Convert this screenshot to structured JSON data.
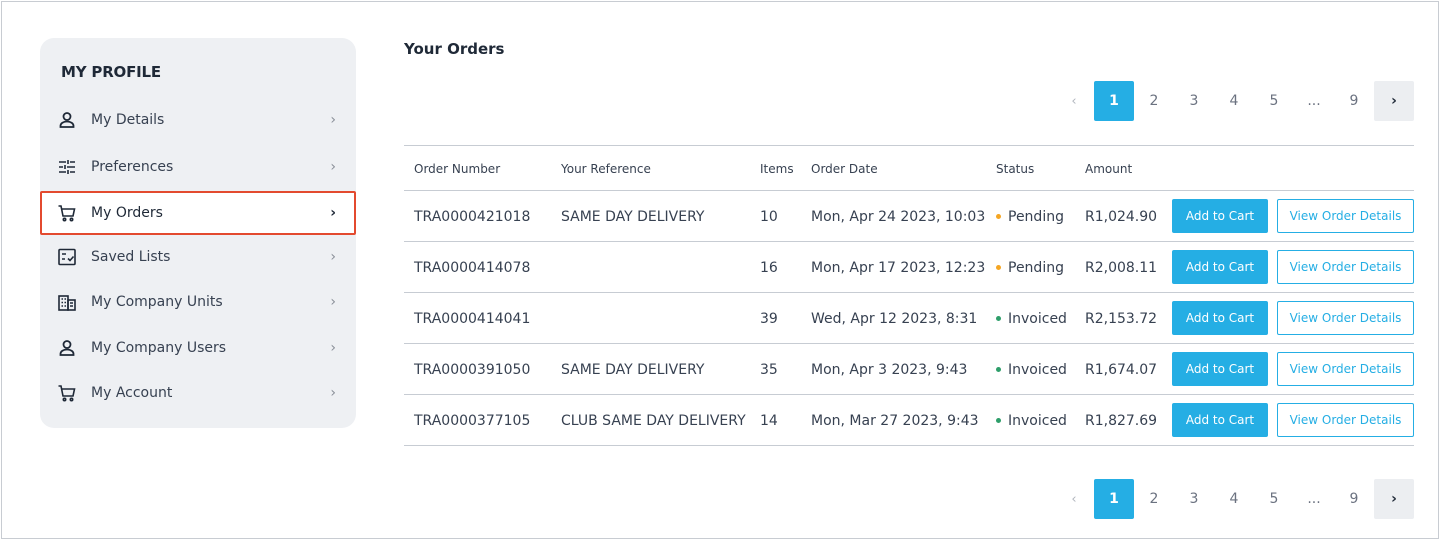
{
  "sidebar": {
    "title": "MY PROFILE",
    "items": [
      {
        "label": "My Details",
        "icon": "user-icon"
      },
      {
        "label": "Preferences",
        "icon": "sliders-icon"
      },
      {
        "label": "My Orders",
        "icon": "cart-icon",
        "active": true
      },
      {
        "label": "Saved Lists",
        "icon": "checklist-icon"
      },
      {
        "label": "My Company Units",
        "icon": "building-icon"
      },
      {
        "label": "My Company Users",
        "icon": "user-icon"
      },
      {
        "label": "My Account",
        "icon": "cart-icon"
      }
    ],
    "chevron": "›"
  },
  "main": {
    "title": "Your Orders",
    "pagination": {
      "prev": "‹",
      "pages": [
        "1",
        "2",
        "3",
        "4",
        "5"
      ],
      "ellipsis": "...",
      "last": "9",
      "next": "›",
      "current": "1"
    },
    "table": {
      "headers": {
        "order_number": "Order Number",
        "reference": "Your Reference",
        "items": "Items",
        "order_date": "Order Date",
        "status": "Status",
        "amount": "Amount"
      },
      "rows": [
        {
          "order_number": "TRA0000421018",
          "reference": "SAME DAY DELIVERY",
          "items": "10",
          "date": "Mon, Apr 24 2023, 10:03",
          "status": "Pending",
          "amount": "R1,024.90"
        },
        {
          "order_number": "TRA0000414078",
          "reference": "",
          "items": "16",
          "date": "Mon, Apr 17 2023, 12:23",
          "status": "Pending",
          "amount": "R2,008.11"
        },
        {
          "order_number": "TRA0000414041",
          "reference": "",
          "items": "39",
          "date": "Wed, Apr 12 2023, 8:31",
          "status": "Invoiced",
          "amount": "R2,153.72"
        },
        {
          "order_number": "TRA0000391050",
          "reference": "SAME DAY DELIVERY",
          "items": "35",
          "date": "Mon, Apr 3 2023, 9:43",
          "status": "Invoiced",
          "amount": "R1,674.07"
        },
        {
          "order_number": "TRA0000377105",
          "reference": "CLUB SAME DAY DELIVERY",
          "items": "14",
          "date": "Mon, Mar 27 2023, 9:43",
          "status": "Invoiced",
          "amount": "R1,827.69"
        }
      ],
      "actions": {
        "add_to_cart": "Add to Cart",
        "view_details": "View Order Details"
      }
    }
  },
  "colors": {
    "accent": "#25aee4",
    "active_outline": "#e34a2f",
    "pending": "#f5a623",
    "invoiced": "#2e9e6a"
  }
}
